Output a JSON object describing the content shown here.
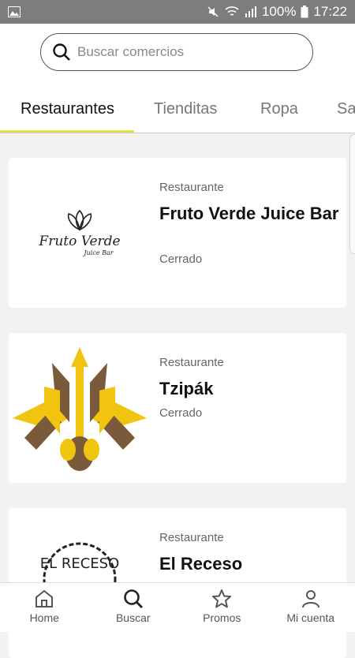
{
  "status_bar": {
    "battery": "100%",
    "time": "17:22",
    "icons": [
      "image-icon",
      "mute-icon",
      "wifi-icon",
      "signal-icon",
      "battery-icon"
    ]
  },
  "search": {
    "placeholder": "Buscar comercios"
  },
  "tabs": [
    {
      "label": "Restaurantes",
      "active": true
    },
    {
      "label": "Tienditas",
      "active": false
    },
    {
      "label": "Ropa",
      "active": false
    },
    {
      "label": "Sa",
      "active": false
    }
  ],
  "accent_color": "#e4e24d",
  "cards": [
    {
      "category": "Restaurante",
      "name": "Fruto Verde Juice Bar",
      "status": "Cerrado",
      "logo_text": "Fruto Verde",
      "logo_subtext": "Juice Bar"
    },
    {
      "category": "Restaurante",
      "name": "Tzipák",
      "status": "Cerrado"
    },
    {
      "category": "Restaurante",
      "name": "El Receso",
      "logo_text": "EL RECESO"
    }
  ],
  "bottom_nav": [
    {
      "label": "Home",
      "icon": "home-icon"
    },
    {
      "label": "Buscar",
      "icon": "search-icon"
    },
    {
      "label": "Promos",
      "icon": "star-icon"
    },
    {
      "label": "Mi cuenta",
      "icon": "user-icon"
    }
  ]
}
